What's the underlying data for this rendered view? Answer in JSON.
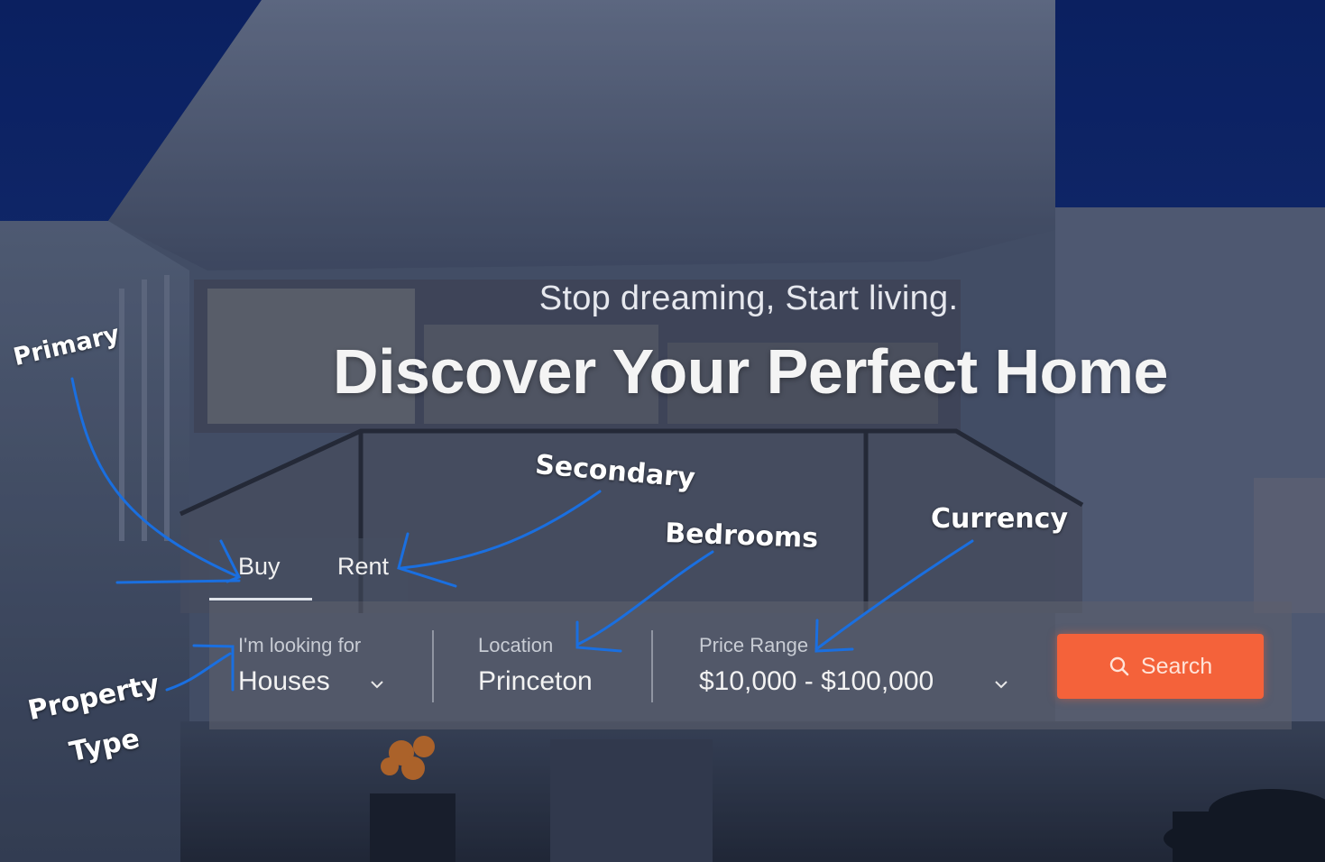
{
  "colors": {
    "sky": "#0d2a78",
    "accent": "#f4623a",
    "annotation_stroke": "#1a6fe0",
    "annotation_text": "#ffffff"
  },
  "hero": {
    "subtitle": "Stop dreaming, Start living.",
    "title": "Discover Your Perfect Home"
  },
  "tabs": [
    {
      "label": "Buy",
      "active": true
    },
    {
      "label": "Rent",
      "active": false
    }
  ],
  "search": {
    "property_type": {
      "label": "I'm looking for",
      "value": "Houses",
      "icon": "chevron-down-icon"
    },
    "location": {
      "label": "Location",
      "value": "Princeton"
    },
    "price_range": {
      "label": "Price Range",
      "value": "$10,000 - $100,000",
      "icon": "chevron-down-icon"
    },
    "button": {
      "label": "Search",
      "icon": "search-icon"
    }
  },
  "annotations": {
    "primary": "Primary",
    "secondary": "Secondary",
    "bedrooms": "Bedrooms",
    "currency": "Currency",
    "property": "Property",
    "type": "Type"
  }
}
